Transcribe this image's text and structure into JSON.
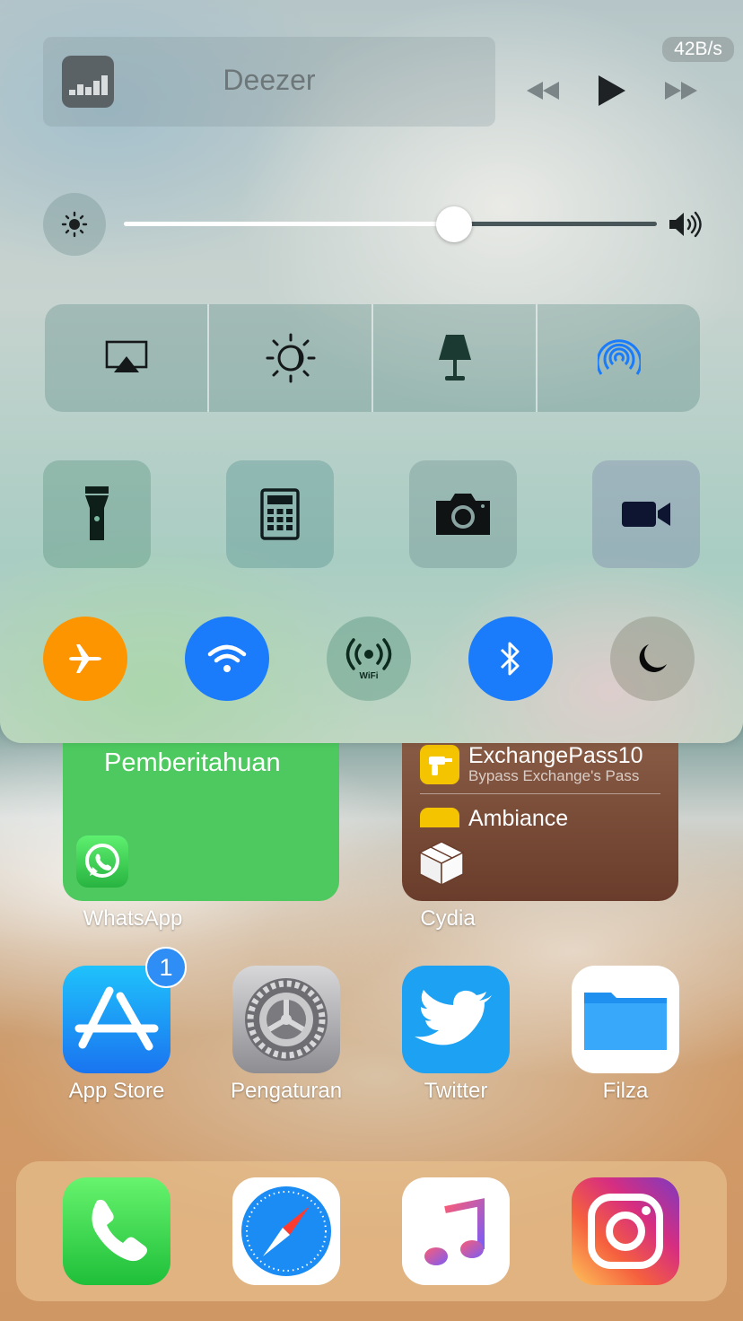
{
  "control_center": {
    "now_playing_app": "Deezer",
    "network_speed": "42B/s",
    "brightness_level": 0.55,
    "icons": {
      "row_quad": [
        "airplay-icon",
        "night-shift-icon",
        "lamp-icon",
        "airdrop-icon"
      ],
      "row_square": [
        "flashlight-icon",
        "calculator-icon",
        "camera-icon",
        "video-camera-icon"
      ],
      "row_round": [
        "airplane-mode-icon",
        "wifi-icon",
        "wifi-hotspot-icon",
        "bluetooth-icon",
        "do-not-disturb-icon"
      ]
    },
    "hotspot_label": "WiFi"
  },
  "widgets": {
    "whatsapp": {
      "title": "Pemberitahuan",
      "label": "WhatsApp"
    },
    "cydia": {
      "items": [
        {
          "title": "ExchangePass10",
          "subtitle": "Bypass Exchange's Pass"
        },
        {
          "title": "Ambiance",
          "subtitle": ""
        }
      ],
      "label": "Cydia"
    }
  },
  "apps": [
    {
      "label": "App Store",
      "badge": "1"
    },
    {
      "label": "Pengaturan"
    },
    {
      "label": "Twitter"
    },
    {
      "label": "Filza"
    }
  ],
  "dock": [
    "Phone",
    "Safari",
    "Music",
    "Instagram"
  ],
  "colors": {
    "airplane_active": "#fd9500",
    "wifi_active": "#1a7bfb",
    "bluetooth_active": "#1a7bfb",
    "airdrop_blue": "#1a7bfb",
    "whatsapp_widget": "#4dc95f",
    "cydia_widget": "#6e4534"
  }
}
